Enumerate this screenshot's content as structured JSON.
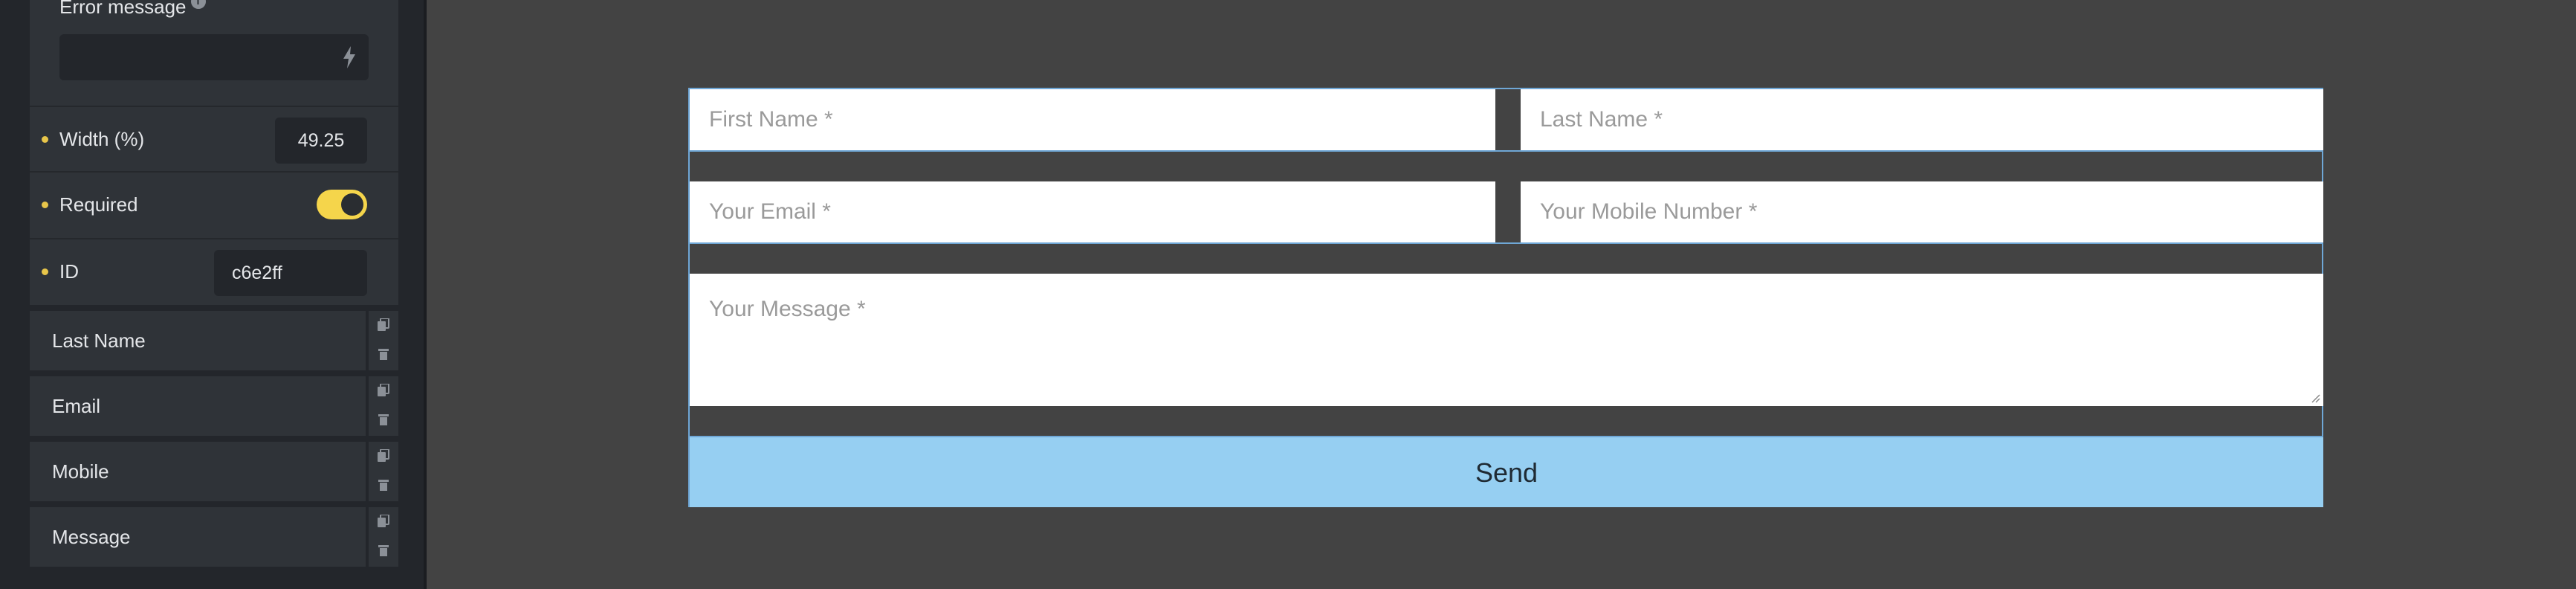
{
  "sidebar": {
    "error_message_label": "Error message",
    "error_message_value": "",
    "width_label": "Width (%)",
    "width_value": "49.25",
    "required_label": "Required",
    "required_on": true,
    "id_label": "ID",
    "id_value": "c6e2ff",
    "fields": [
      {
        "label": "Last Name"
      },
      {
        "label": "Email"
      },
      {
        "label": "Mobile"
      },
      {
        "label": "Message"
      }
    ]
  },
  "form": {
    "first_name_placeholder": "First Name *",
    "last_name_placeholder": "Last Name *",
    "email_placeholder": "Your Email *",
    "mobile_placeholder": "Your Mobile Number *",
    "message_placeholder": "Your Message *",
    "send_label": "Send"
  },
  "colors": {
    "accent": "#f5d54b",
    "button": "#96cff2",
    "selection": "#6fa7d6"
  }
}
